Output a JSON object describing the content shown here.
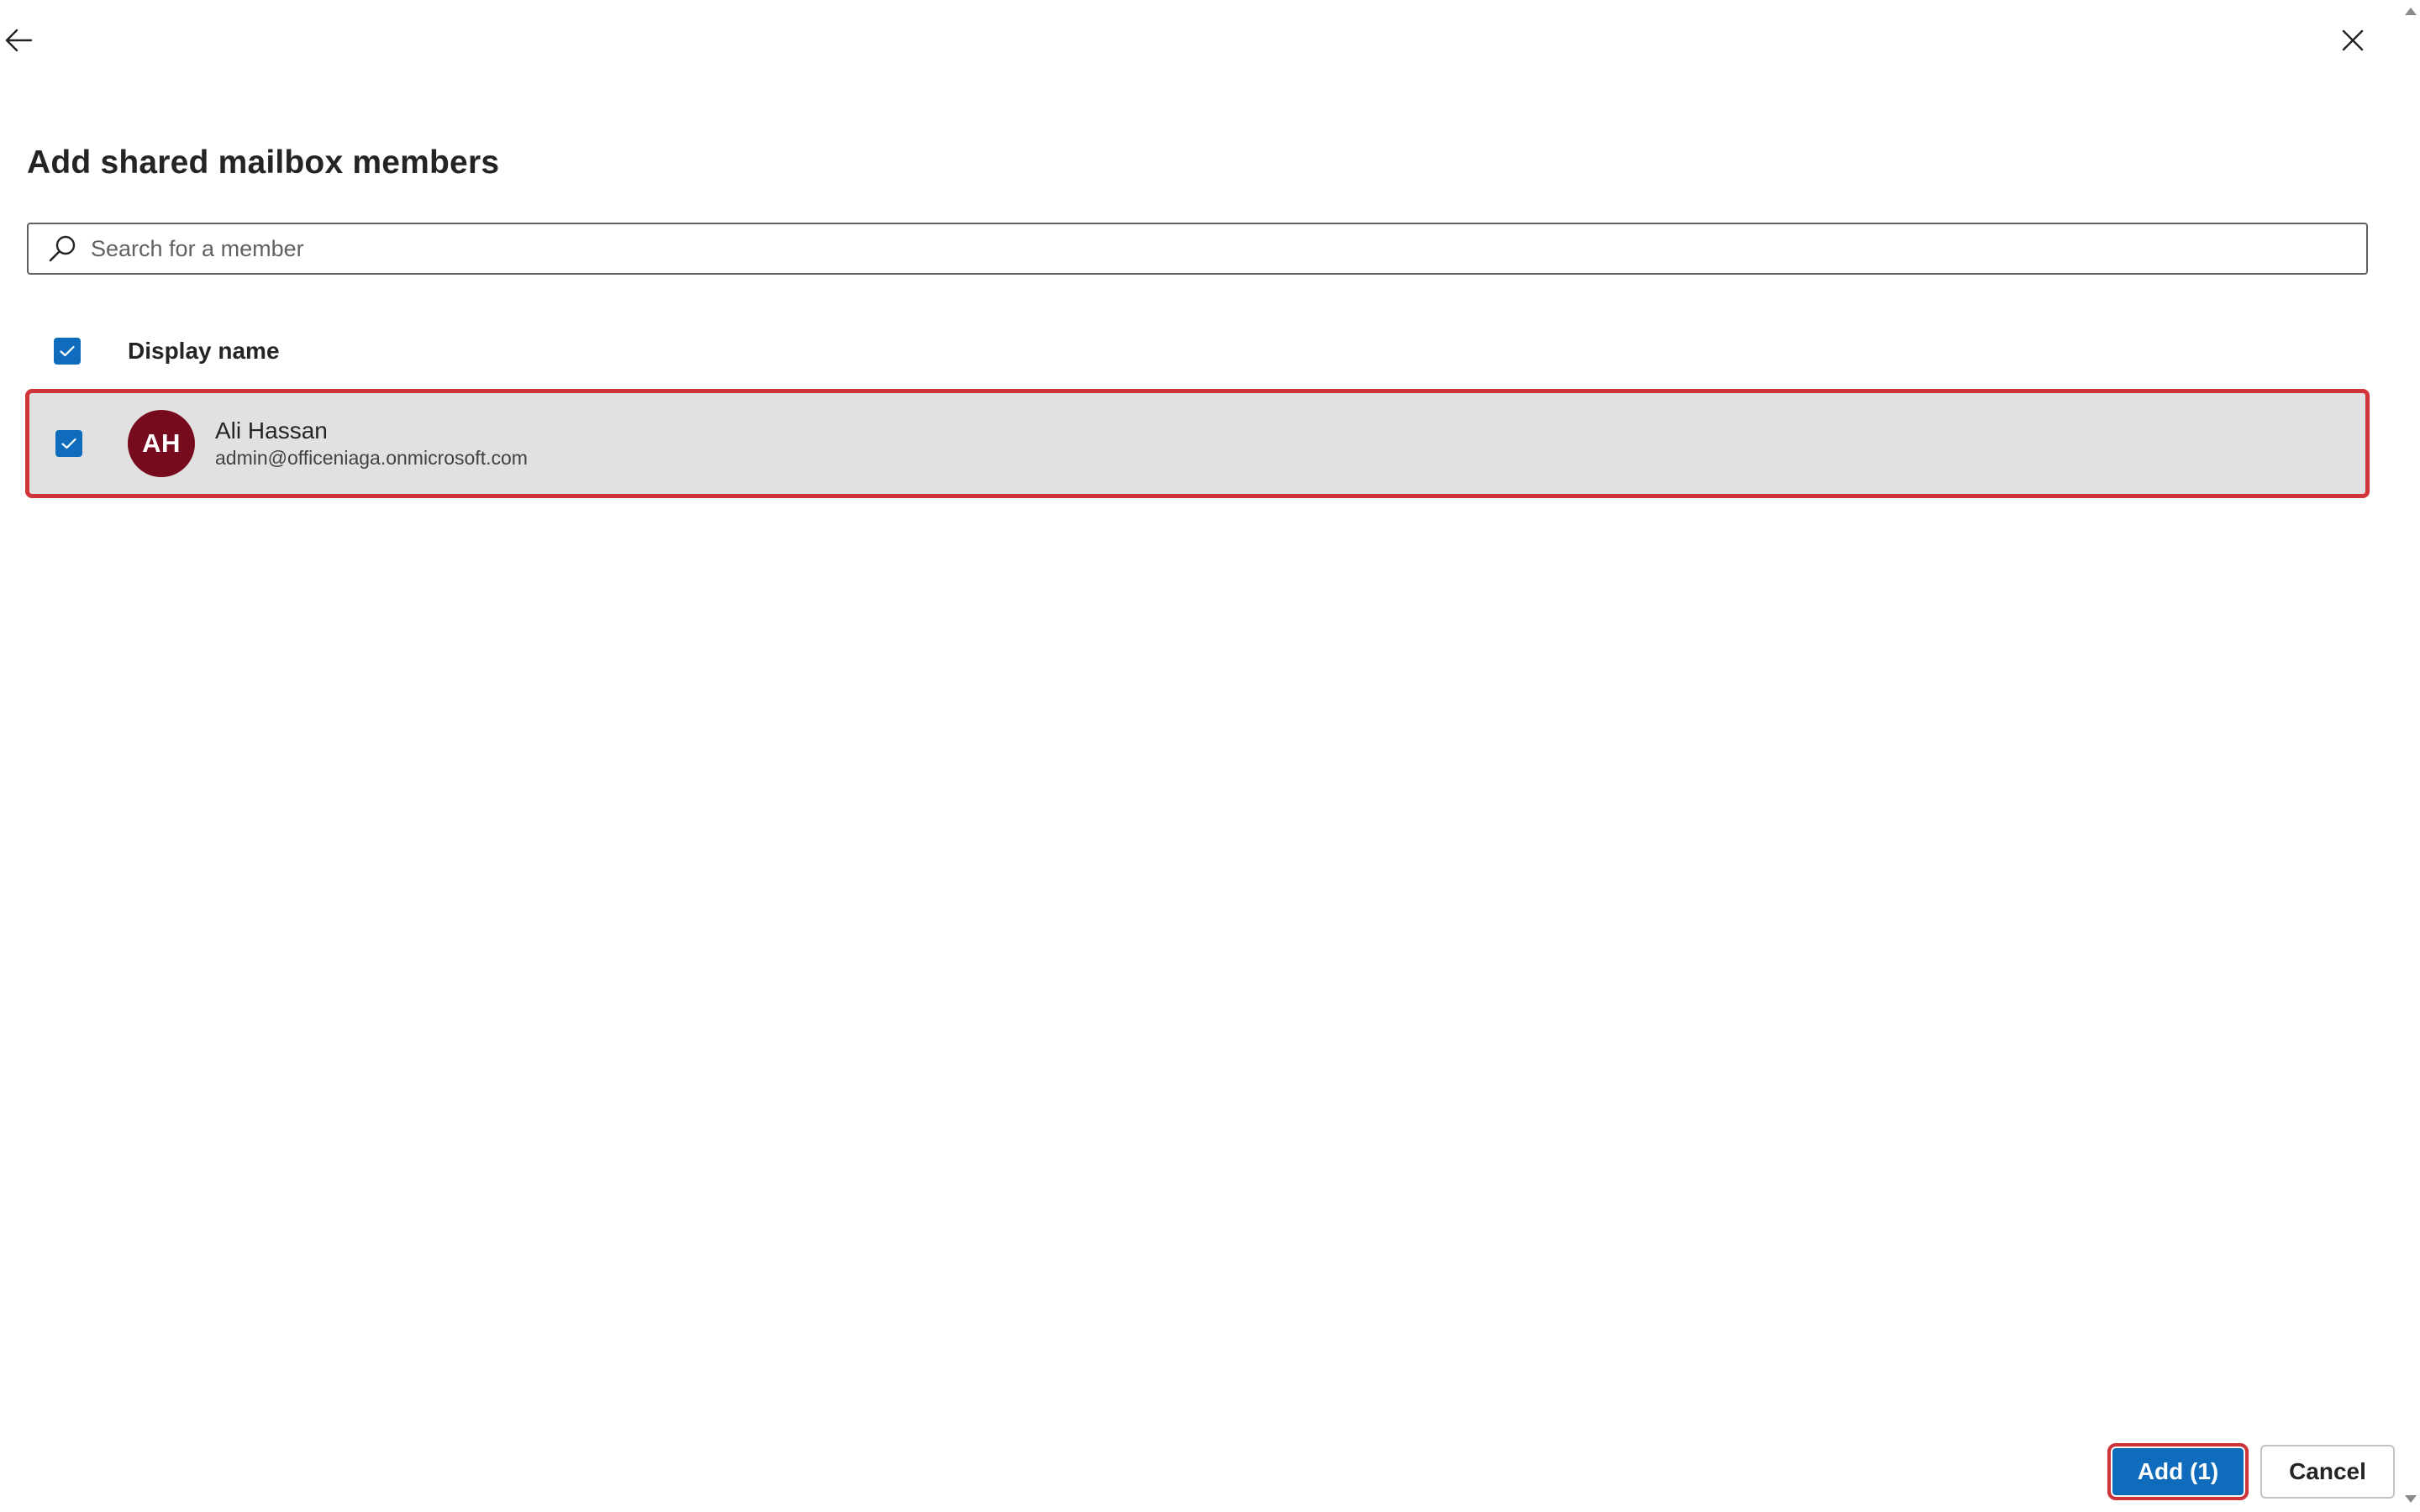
{
  "header": {
    "back_icon": "arrow-left-icon",
    "close_icon": "close-icon"
  },
  "panel": {
    "title": "Add shared mailbox members"
  },
  "search": {
    "placeholder": "Search for a member",
    "value": "",
    "icon": "search-icon"
  },
  "list": {
    "select_all_checked": true,
    "columns": [
      {
        "label": "Display name"
      }
    ],
    "members": [
      {
        "initials": "AH",
        "name": "Ali Hassan",
        "email": "admin@officeniaga.onmicrosoft.com",
        "checked": true,
        "avatar_color": "#750b1c"
      }
    ]
  },
  "footer": {
    "add_label": "Add (1)",
    "cancel_label": "Cancel"
  },
  "colors": {
    "accent": "#0f6cbd",
    "highlight_border": "#d13438",
    "selected_row_bg": "#e1e1e1"
  }
}
